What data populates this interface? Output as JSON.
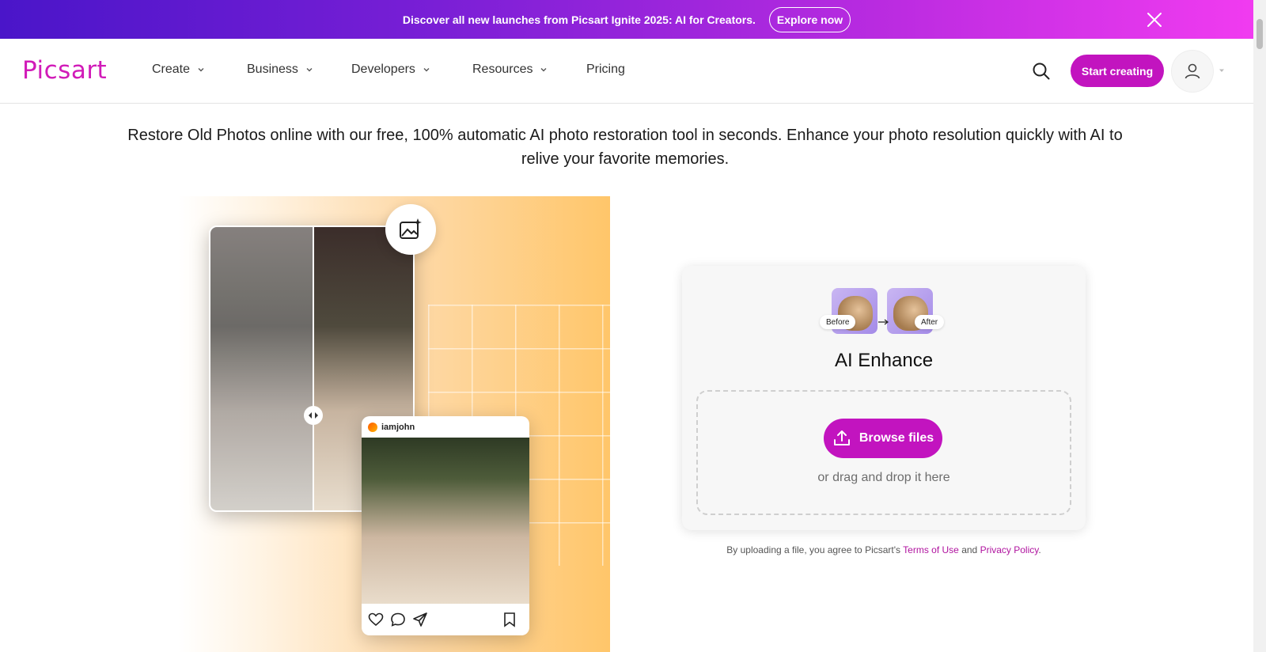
{
  "banner": {
    "text": "Discover all new launches from Picsart Ignite 2025: AI for Creators.",
    "cta": "Explore now"
  },
  "nav": {
    "logo": "Picsart",
    "items": [
      {
        "label": "Create",
        "has_dropdown": true
      },
      {
        "label": "Business",
        "has_dropdown": true
      },
      {
        "label": "Developers",
        "has_dropdown": true
      },
      {
        "label": "Resources",
        "has_dropdown": true
      },
      {
        "label": "Pricing",
        "has_dropdown": false
      }
    ],
    "start_button": "Start creating"
  },
  "intro": {
    "text": "Restore Old Photos online with our free, 100% automatic AI photo restoration tool in seconds. Enhance your photo resolution quickly with AI to relive your favorite memories."
  },
  "hero": {
    "post_username": "iamjohn"
  },
  "tool": {
    "before_label": "Before",
    "after_label": "After",
    "title": "AI Enhance",
    "browse_button": "Browse files",
    "drop_text": "or drag and drop it here"
  },
  "legal": {
    "prefix": "By uploading a file, you agree to Picsart's",
    "terms": "Terms of Use",
    "and": "and",
    "privacy": "Privacy Policy",
    "suffix": "."
  },
  "colors": {
    "brand": "#c214bf",
    "banner_gradient_start": "#4a15c9",
    "banner_gradient_end": "#f13bf0",
    "hero_accent": "#ffc66a"
  }
}
